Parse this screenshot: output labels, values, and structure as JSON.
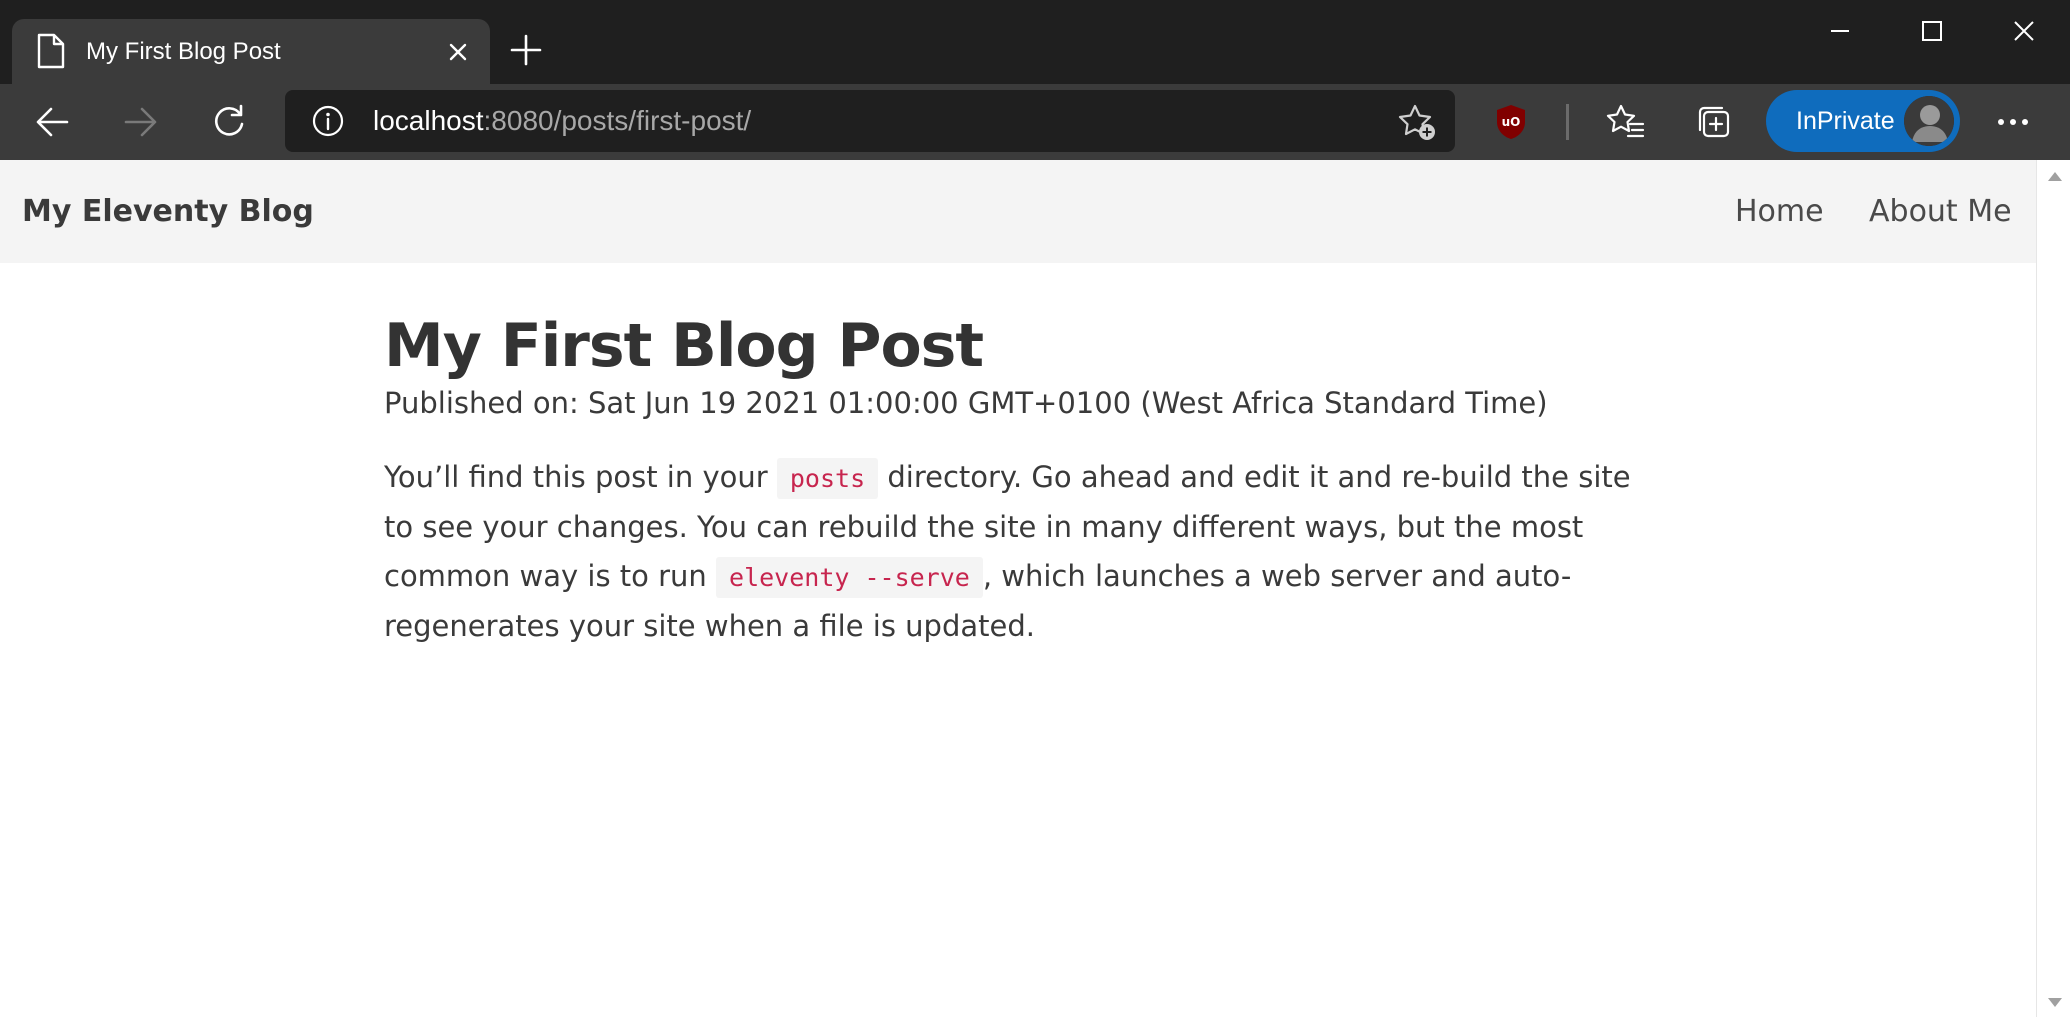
{
  "browser": {
    "tab": {
      "title": "My First Blog Post"
    },
    "address": {
      "host": "localhost",
      "rest": ":8080/posts/first-post/"
    },
    "profile": {
      "label": "InPrivate"
    },
    "icons": {
      "page": "page-icon",
      "close": "close-icon",
      "new_tab": "plus-icon",
      "back": "back-arrow-icon",
      "forward": "forward-arrow-icon",
      "refresh": "refresh-icon",
      "info": "info-icon",
      "favorite_add": "star-add-icon",
      "ublock": "ublock-origin-icon",
      "favorites": "favorites-icon",
      "collections": "collections-icon",
      "more": "more-icon"
    },
    "colors": {
      "chrome": "#1f1f1f",
      "toolbar": "#3b3b3b",
      "inprivate": "#0f6cbd",
      "ublock": "#800000"
    }
  },
  "site": {
    "brand": "My Eleventy Blog",
    "nav": [
      {
        "label": "Home"
      },
      {
        "label": "About Me"
      }
    ]
  },
  "post": {
    "title": "My First Blog Post",
    "date": "Published on: Sat Jun 19 2021 01:00:00 GMT+0100 (West Africa Standard Time)",
    "body": {
      "part1": "You’ll find this post in your ",
      "code1": "posts",
      "part2": " directory. Go ahead and edit it and re-build the site to see your changes. You can rebuild the site in many different ways, but the most common way is to run ",
      "code2": "eleventy --serve",
      "part3": ", which launches a web server and auto-regenerates your site when a file is updated."
    }
  }
}
